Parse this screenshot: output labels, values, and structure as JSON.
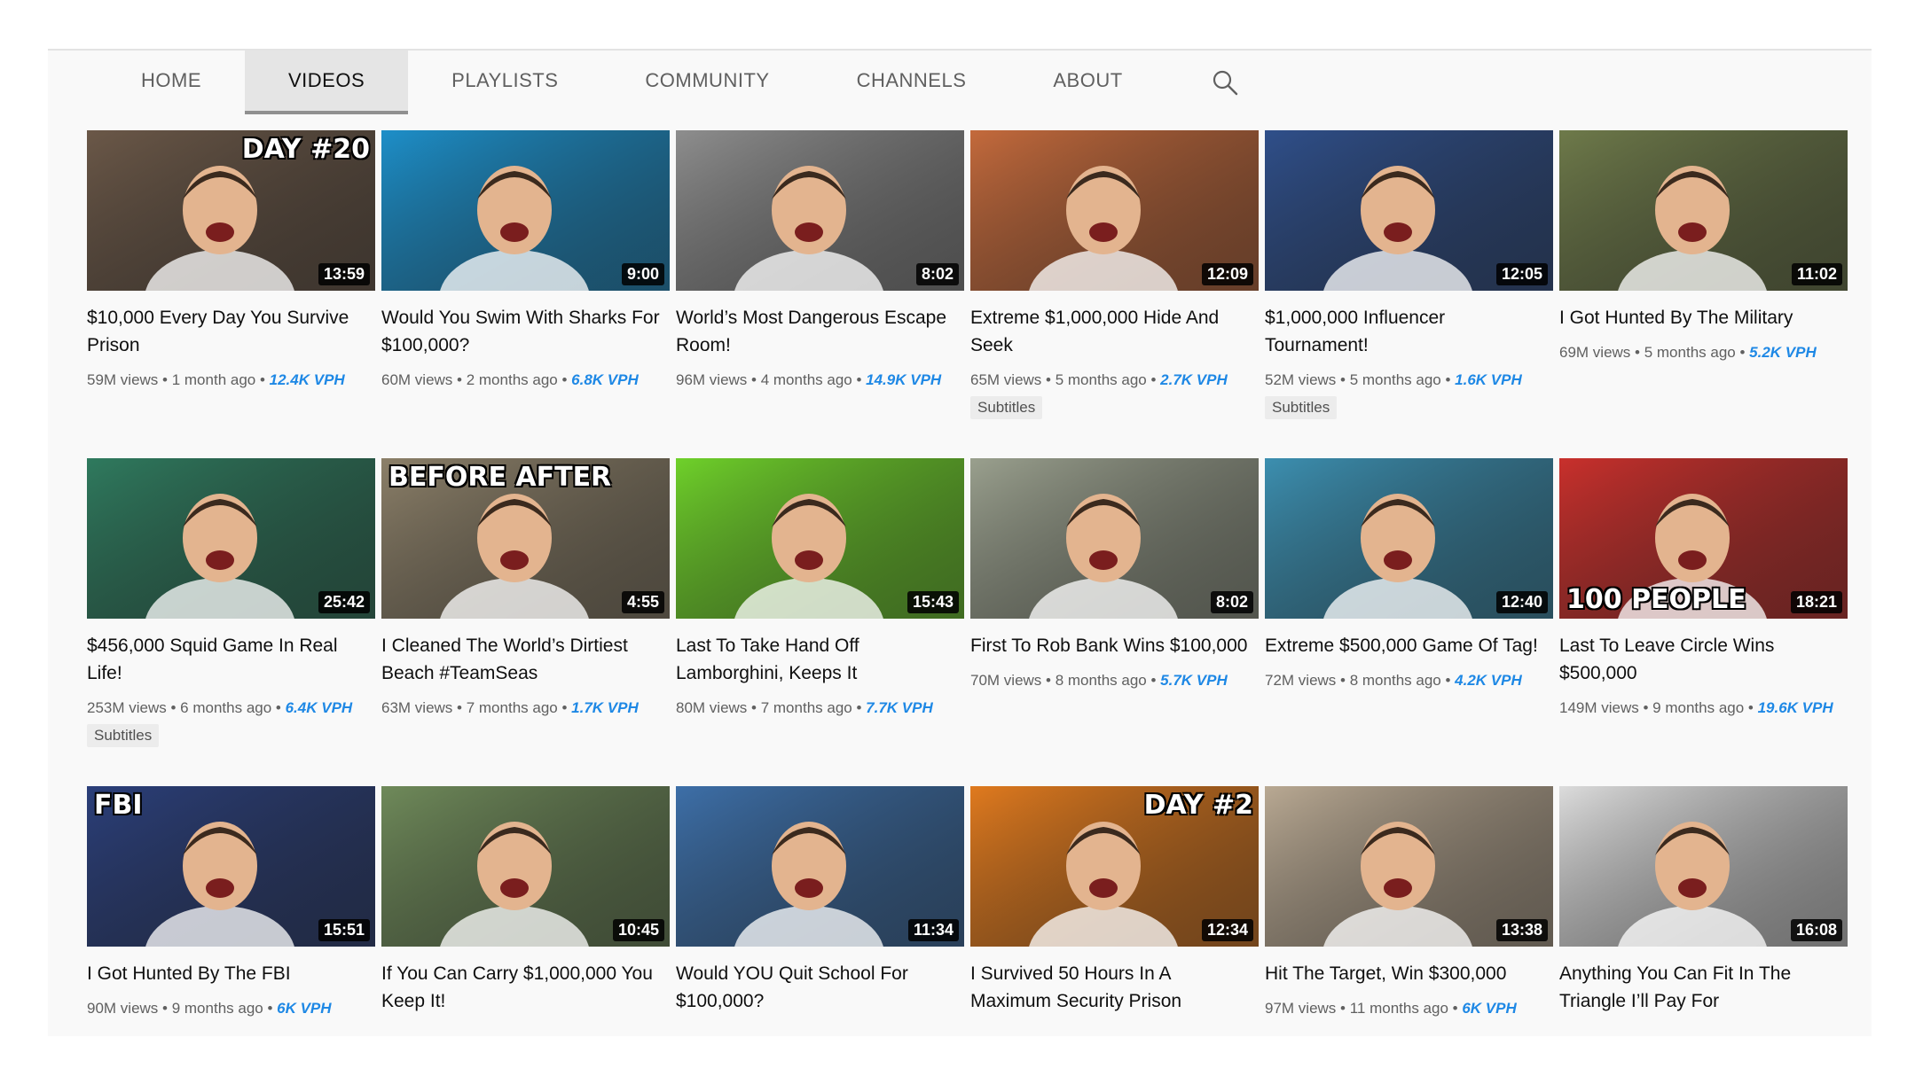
{
  "tabs": [
    {
      "label": "HOME"
    },
    {
      "label": "VIDEOS"
    },
    {
      "label": "PLAYLISTS"
    },
    {
      "label": "COMMUNITY"
    },
    {
      "label": "CHANNELS"
    },
    {
      "label": "ABOUT"
    }
  ],
  "active_tab": "VIDEOS",
  "videos": [
    {
      "title": "$10,000 Every Day You Survive Prison",
      "duration": "13:59",
      "views": "59M views",
      "age": "1 month ago",
      "vph": "12.4K VPH",
      "badge": "",
      "overlay": "DAY #20",
      "bg": "#6b5848"
    },
    {
      "title": "Would You Swim With Sharks For $100,000?",
      "duration": "9:00",
      "views": "60M views",
      "age": "2 months ago",
      "vph": "6.8K VPH",
      "badge": "",
      "overlay": "",
      "bg": "#1d8fc9"
    },
    {
      "title": "World’s Most Dangerous Escape Room!",
      "duration": "8:02",
      "views": "96M views",
      "age": "4 months ago",
      "vph": "14.9K VPH",
      "badge": "",
      "overlay": "",
      "bg": "#8e8e8e"
    },
    {
      "title": "Extreme $1,000,000 Hide And Seek",
      "duration": "12:09",
      "views": "65M views",
      "age": "5 months ago",
      "vph": "2.7K VPH",
      "badge": "Subtitles",
      "overlay": "",
      "bg": "#c46a3c"
    },
    {
      "title": "$1,000,000 Influencer Tournament!",
      "duration": "12:05",
      "views": "52M views",
      "age": "5 months ago",
      "vph": "1.6K VPH",
      "badge": "Subtitles",
      "overlay": "",
      "bg": "#2f4f8a"
    },
    {
      "title": "I Got Hunted By The Military",
      "duration": "11:02",
      "views": "69M views",
      "age": "5 months ago",
      "vph": "5.2K VPH",
      "badge": "",
      "overlay": "",
      "bg": "#6e7a4a"
    },
    {
      "title": "$456,000 Squid Game In Real Life!",
      "duration": "25:42",
      "views": "253M views",
      "age": "6 months ago",
      "vph": "6.4K VPH",
      "badge": "Subtitles",
      "overlay": "",
      "bg": "#2f7a5e"
    },
    {
      "title": "I Cleaned The World’s Dirtiest Beach #TeamSeas",
      "duration": "4:55",
      "views": "63M views",
      "age": "7 months ago",
      "vph": "1.7K VPH",
      "badge": "",
      "overlay": "BEFORE    AFTER",
      "bg": "#8c8069"
    },
    {
      "title": "Last To Take Hand Off Lamborghini, Keeps It",
      "duration": "15:43",
      "views": "80M views",
      "age": "7 months ago",
      "vph": "7.7K VPH",
      "badge": "",
      "overlay": "",
      "bg": "#6fd12a"
    },
    {
      "title": "First To Rob Bank Wins $100,000",
      "duration": "8:02",
      "views": "70M views",
      "age": "8 months ago",
      "vph": "5.7K VPH",
      "badge": "",
      "overlay": "",
      "bg": "#9aa08e"
    },
    {
      "title": "Extreme $500,000 Game Of Tag!",
      "duration": "12:40",
      "views": "72M views",
      "age": "8 months ago",
      "vph": "4.2K VPH",
      "badge": "",
      "overlay": "",
      "bg": "#3c8fb0"
    },
    {
      "title": "Last To Leave Circle Wins $500,000",
      "duration": "18:21",
      "views": "149M views",
      "age": "9 months ago",
      "vph": "19.6K VPH",
      "badge": "",
      "overlay": "100 PEOPLE",
      "bg": "#c9302c"
    },
    {
      "title": "I Got Hunted By The FBI",
      "duration": "15:51",
      "views": "90M views",
      "age": "9 months ago",
      "vph": "6K VPH",
      "badge": "",
      "overlay": "FBI",
      "bg": "#2b3f7a"
    },
    {
      "title": "If You Can Carry $1,000,000 You Keep It!",
      "duration": "10:45",
      "views": "",
      "age": "",
      "vph": "",
      "badge": "",
      "overlay": "",
      "bg": "#6f8a5a"
    },
    {
      "title": "Would YOU Quit School For $100,000?",
      "duration": "11:34",
      "views": "",
      "age": "",
      "vph": "",
      "badge": "",
      "overlay": "",
      "bg": "#3d6fa8"
    },
    {
      "title": "I Survived 50 Hours In A Maximum Security Prison",
      "duration": "12:34",
      "views": "",
      "age": "",
      "vph": "",
      "badge": "",
      "overlay": "DAY #2",
      "bg": "#e07a1e"
    },
    {
      "title": "Hit The Target, Win $300,000",
      "duration": "13:38",
      "views": "97M views",
      "age": "11 months ago",
      "vph": "6K VPH",
      "badge": "",
      "overlay": "",
      "bg": "#b9a993"
    },
    {
      "title": "Anything You Can Fit In The Triangle I’ll Pay For",
      "duration": "16:08",
      "views": "",
      "age": "",
      "vph": "",
      "badge": "",
      "overlay": "",
      "bg": "#dcdcdc"
    }
  ]
}
